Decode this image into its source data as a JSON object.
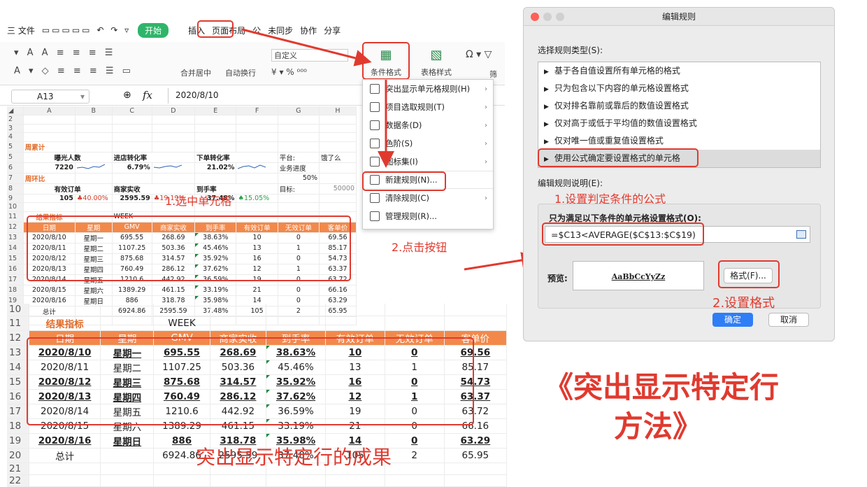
{
  "menubar": {
    "items": [
      "三 文件",
      "插入",
      "页面布局",
      "公"
    ],
    "start_tab": "开始",
    "sync": "未同步",
    "collab": "协作",
    "share": "分享"
  },
  "ribbon": {
    "merge": "合并居中",
    "wrap": "自动换行",
    "num_format": "自定义",
    "cond_format": "条件格式",
    "table_style": "表格样式",
    "filter": "筛"
  },
  "formula_bar": {
    "cell": "A13",
    "fx": "fx",
    "value": "2020/8/10"
  },
  "sheet": {
    "col_headers": [
      "A",
      "B",
      "C",
      "D",
      "E",
      "F",
      "G",
      "H"
    ],
    "week_label": "周累计",
    "exposure": "曝光人数",
    "exposure_val": "7220",
    "store_rate": "进店转化率",
    "store_rate_val": "6.79%",
    "order_rate": "下单转化率",
    "order_rate_val": "21.02%",
    "platform": "平台:",
    "platform_val": "饿了么",
    "progress": "业务进度",
    "progress_val": "50%",
    "mom": "周环比",
    "valid_orders": "有效订单",
    "valid_orders_val": "105",
    "valid_orders_chg": "40.00%",
    "merchant": "商家实收",
    "merchant_val": "2595.59",
    "merchant_chg": "19.19%",
    "arrival": "到手率",
    "arrival_val": "37.48%",
    "arrival_chg": "15.05%",
    "target": "目标:",
    "target_val": "50000",
    "result_label": "结果指标",
    "week": "WEEK",
    "headers": [
      "日期",
      "星期",
      "GMV",
      "商家实收",
      "到手率",
      "有效订单",
      "无效订单",
      "客单价"
    ],
    "rows": [
      [
        "2020/8/10",
        "星期一",
        "695.55",
        "268.69",
        "38.63%",
        "10",
        "0",
        "69.56"
      ],
      [
        "2020/8/11",
        "星期二",
        "1107.25",
        "503.36",
        "45.46%",
        "13",
        "1",
        "85.17"
      ],
      [
        "2020/8/12",
        "星期三",
        "875.68",
        "314.57",
        "35.92%",
        "16",
        "0",
        "54.73"
      ],
      [
        "2020/8/13",
        "星期四",
        "760.49",
        "286.12",
        "37.62%",
        "12",
        "1",
        "63.37"
      ],
      [
        "2020/8/14",
        "星期五",
        "1210.6",
        "442.92",
        "36.59%",
        "19",
        "0",
        "63.72"
      ],
      [
        "2020/8/15",
        "星期六",
        "1389.29",
        "461.15",
        "33.19%",
        "21",
        "0",
        "66.16"
      ],
      [
        "2020/8/16",
        "星期日",
        "886",
        "318.78",
        "35.98%",
        "14",
        "0",
        "63.29"
      ]
    ],
    "total": [
      "总计",
      "",
      "6924.86",
      "2595.59",
      "37.48%",
      "105",
      "2",
      "65.95"
    ]
  },
  "menu": {
    "items": [
      "突出显示单元格规则(H)",
      "项目选取规则(T)",
      "数据条(D)",
      "色阶(S)",
      "图标集(I)",
      "新建规则(N)...",
      "清除规则(C)",
      "管理规则(R)..."
    ]
  },
  "dialog": {
    "title": "编辑规则",
    "select_type": "选择规则类型(S):",
    "rule_types": [
      "基于各自值设置所有单元格的格式",
      "只为包含以下内容的单元格设置格式",
      "仅对排名靠前或靠后的数值设置格式",
      "仅对高于或低于平均值的数值设置格式",
      "仅对唯一值或重复值设置格式",
      "使用公式确定要设置格式的单元格"
    ],
    "edit_desc": "编辑规则说明(E):",
    "formula_label": "只为满足以下条件的单元格设置格式(O):",
    "formula": "=$C13<AVERAGE($C$13:$C$19)",
    "preview_label": "预览:",
    "preview_text": "AaBbCcYyZz",
    "format_btn": "格式(F)...",
    "ok": "确定",
    "cancel": "取消"
  },
  "annotations": {
    "a1": "1.选中单元格",
    "a2": "2.点击按钮",
    "d1": "1.设置判定条件的公式",
    "d2": "2.设置格式",
    "result": "突出显示特定行的成果",
    "title1": "《突出显示特定行",
    "title2": "方法》"
  },
  "colors": {
    "accent_red": "#e03a2f",
    "header_orange": "#f2894b",
    "start_green": "#2fb56a",
    "ok_blue": "#2f7ef6"
  }
}
